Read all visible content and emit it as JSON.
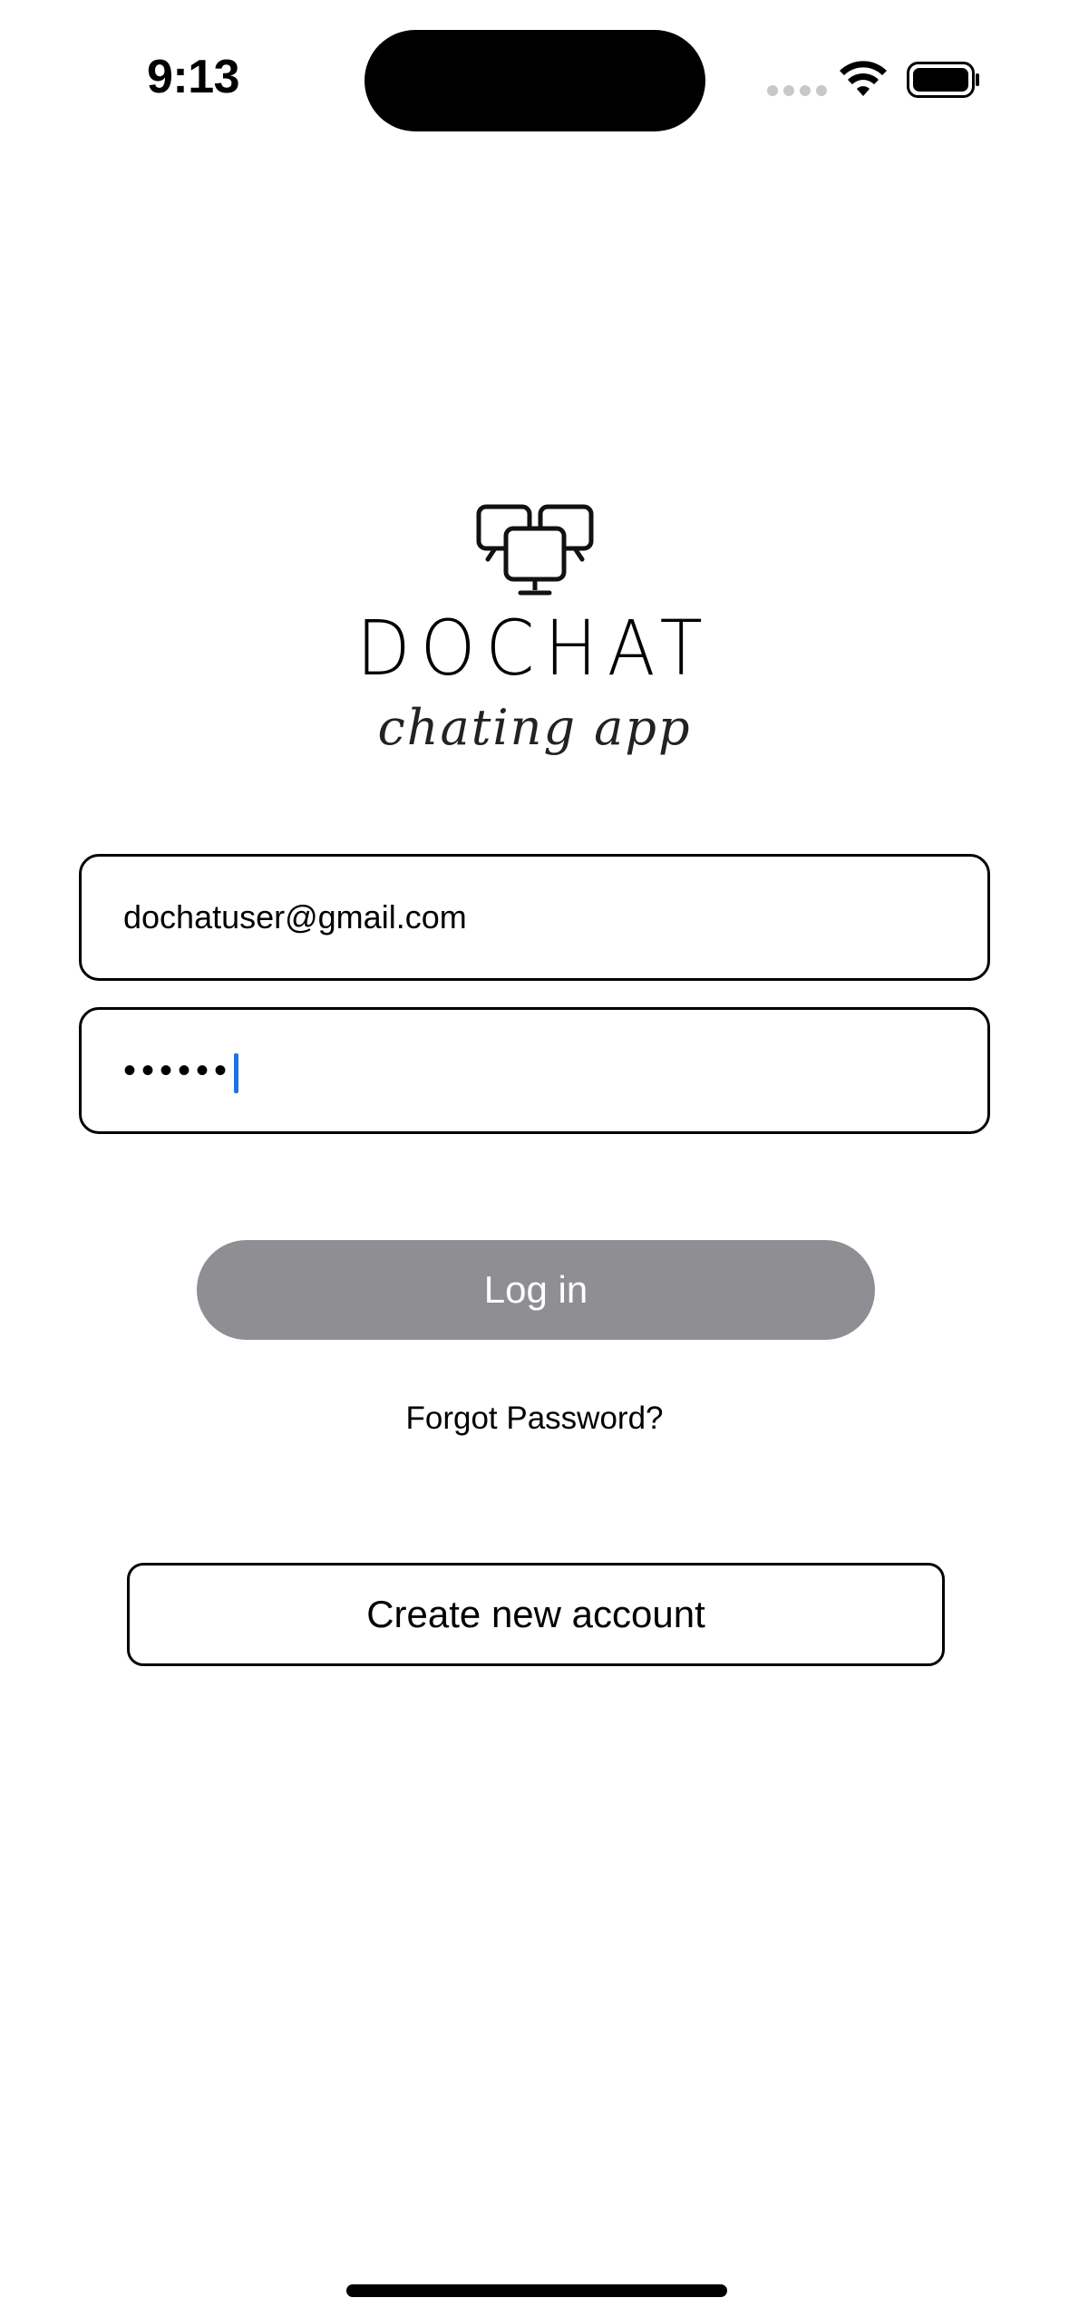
{
  "status_bar": {
    "time": "9:13",
    "icons": [
      "signal-icon",
      "wifi-icon",
      "battery-icon"
    ]
  },
  "logo": {
    "icon": "monitors-logo-icon",
    "title": "DOCHAT",
    "subtitle": "chating app"
  },
  "form": {
    "email_value": "dochatuser@gmail.com",
    "password_masked": "••••••"
  },
  "buttons": {
    "login_label": "Log in",
    "forgot_label": "Forgot Password?",
    "create_account_label": "Create new account"
  },
  "colors": {
    "login_button_bg": "#8e8e93",
    "caret": "#1a73e8",
    "border": "#000000"
  }
}
